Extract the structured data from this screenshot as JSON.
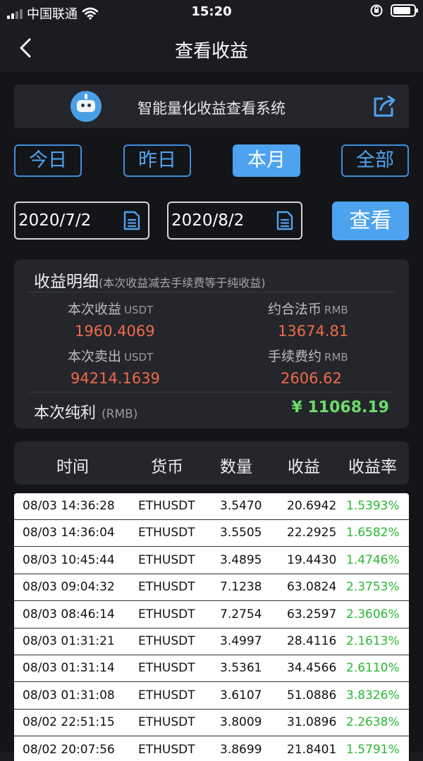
{
  "status_bar": {
    "carrier": "中国联通",
    "time": "15:20"
  },
  "nav": {
    "title": "查看收益"
  },
  "banner": {
    "text": "智能量化收益查看系统"
  },
  "range_tabs": [
    {
      "label": "今日",
      "active": false
    },
    {
      "label": "昨日",
      "active": false
    },
    {
      "label": "本月",
      "active": true
    },
    {
      "label": "全部",
      "active": false
    }
  ],
  "date_filter": {
    "start": "2020/7/2",
    "end": "2020/8/2",
    "query_label": "查看"
  },
  "summary": {
    "title": "收益明细",
    "note": "(本次收益减去手续费等于纯收益)",
    "current_profit": {
      "label": "本次收益",
      "unit": "USDT",
      "value": "1960.4069"
    },
    "fiat_equiv": {
      "label": "约合法币",
      "unit": "RMB",
      "value": "13674.81"
    },
    "current_sell": {
      "label": "本次卖出",
      "unit": "USDT",
      "value": "94214.1639"
    },
    "fee": {
      "label": "手续费约",
      "unit": "RMB",
      "value": "2606.62"
    },
    "net_profit": {
      "label": "本次纯利",
      "unit": "(RMB)",
      "value": "¥ 11068.19"
    }
  },
  "table": {
    "headers": [
      "时间",
      "货币",
      "数量",
      "收益",
      "收益率"
    ],
    "rows": [
      [
        "08/03 14:36:28",
        "ETHUSDT",
        "3.5470",
        "20.6942",
        "1.5393%"
      ],
      [
        "08/03 14:36:04",
        "ETHUSDT",
        "3.5505",
        "22.2925",
        "1.6582%"
      ],
      [
        "08/03 10:45:44",
        "ETHUSDT",
        "3.4895",
        "19.4430",
        "1.4746%"
      ],
      [
        "08/03 09:04:32",
        "ETHUSDT",
        "7.1238",
        "63.0824",
        "2.3753%"
      ],
      [
        "08/03 08:46:14",
        "ETHUSDT",
        "7.2754",
        "63.2597",
        "2.3606%"
      ],
      [
        "08/03 01:31:21",
        "ETHUSDT",
        "3.4997",
        "28.4116",
        "2.1613%"
      ],
      [
        "08/03 01:31:14",
        "ETHUSDT",
        "3.5361",
        "34.4566",
        "2.6110%"
      ],
      [
        "08/03 01:31:08",
        "ETHUSDT",
        "3.6107",
        "51.0886",
        "3.8326%"
      ],
      [
        "08/02 22:51:15",
        "ETHUSDT",
        "3.8009",
        "31.0896",
        "2.2638%"
      ],
      [
        "08/02 20:07:56",
        "ETHUSDT",
        "3.8699",
        "21.8401",
        "1.5791%"
      ]
    ]
  },
  "colors": {
    "accent": "#4ea3f0",
    "loss_red": "#f06a4a",
    "profit_green": "#6ddc6a",
    "rate_green": "#28b832"
  }
}
